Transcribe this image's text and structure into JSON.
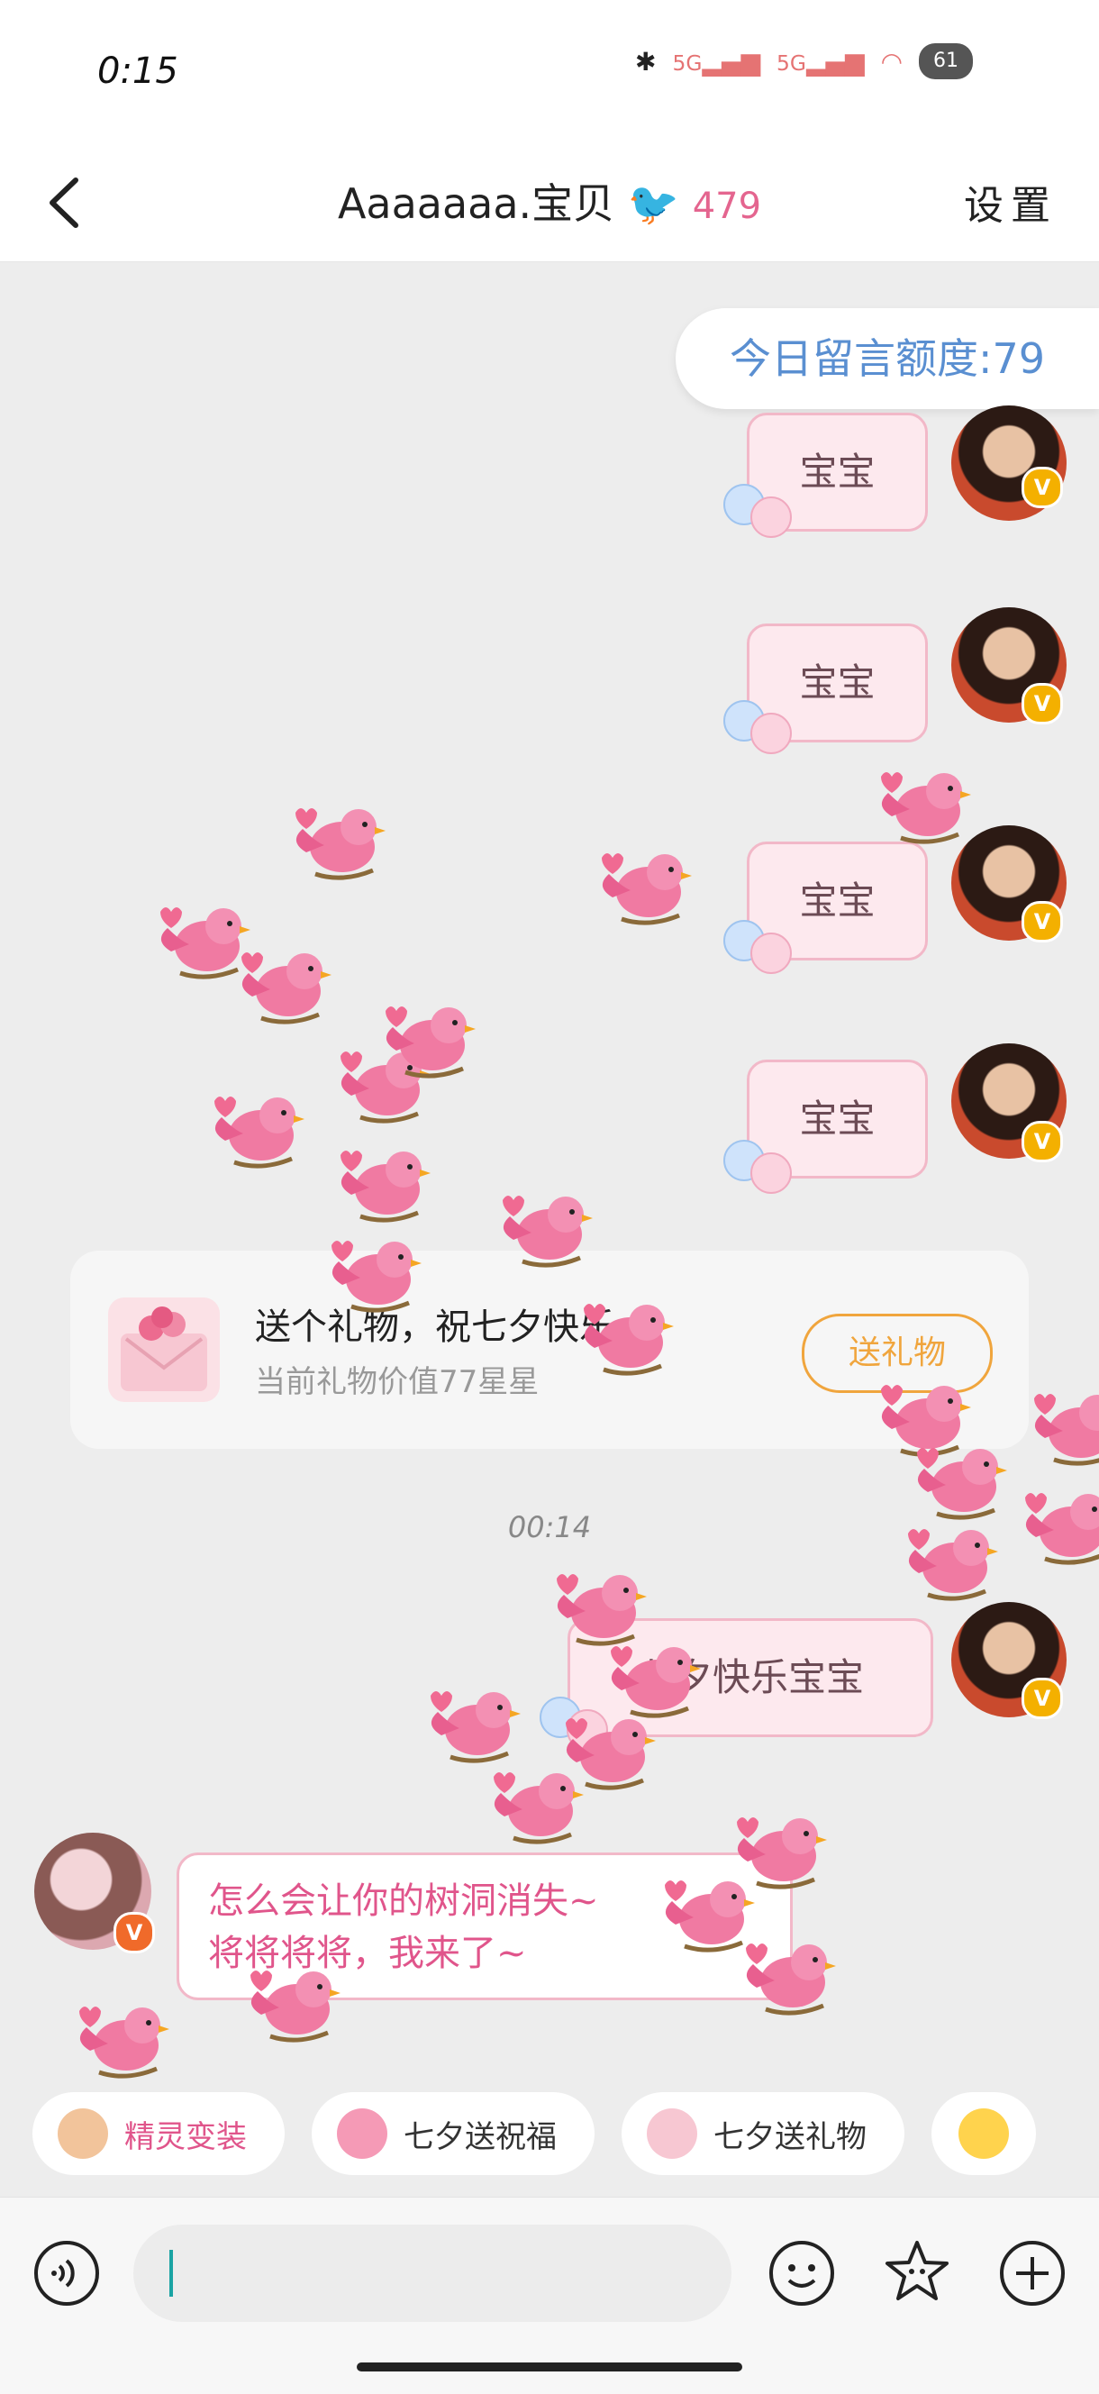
{
  "status": {
    "time": "0:15",
    "signal1": "5G",
    "signal2": "5G",
    "battery": "61"
  },
  "nav": {
    "title": "Aaaaaaa.宝贝",
    "score": "479",
    "settings": "设置"
  },
  "quota": "今日留言额度:79",
  "messages": [
    {
      "text": "宝宝"
    },
    {
      "text": "宝宝"
    },
    {
      "text": "宝宝"
    },
    {
      "text": "宝宝"
    }
  ],
  "gift": {
    "title": "送个礼物，祝七夕快乐~",
    "subtitle": "当前礼物价值77星星",
    "button": "送礼物"
  },
  "timestamp": "00:14",
  "outgoing_last": "七夕快乐宝宝",
  "incoming": {
    "line1": "怎么会让你的树洞消失~",
    "line2": "将将将将，我来了~"
  },
  "chips": [
    {
      "label": "精灵变装",
      "icon": "monkey-icon"
    },
    {
      "label": "七夕送祝福",
      "icon": "pink-bird-icon"
    },
    {
      "label": "七夕送礼物",
      "icon": "gift-envelope-icon"
    }
  ],
  "colors": {
    "accent_pink": "#e0558b",
    "quota_blue": "#5a8fd1",
    "gift_orange": "#f0a53d",
    "bubble_pink": "#fde9ee"
  }
}
